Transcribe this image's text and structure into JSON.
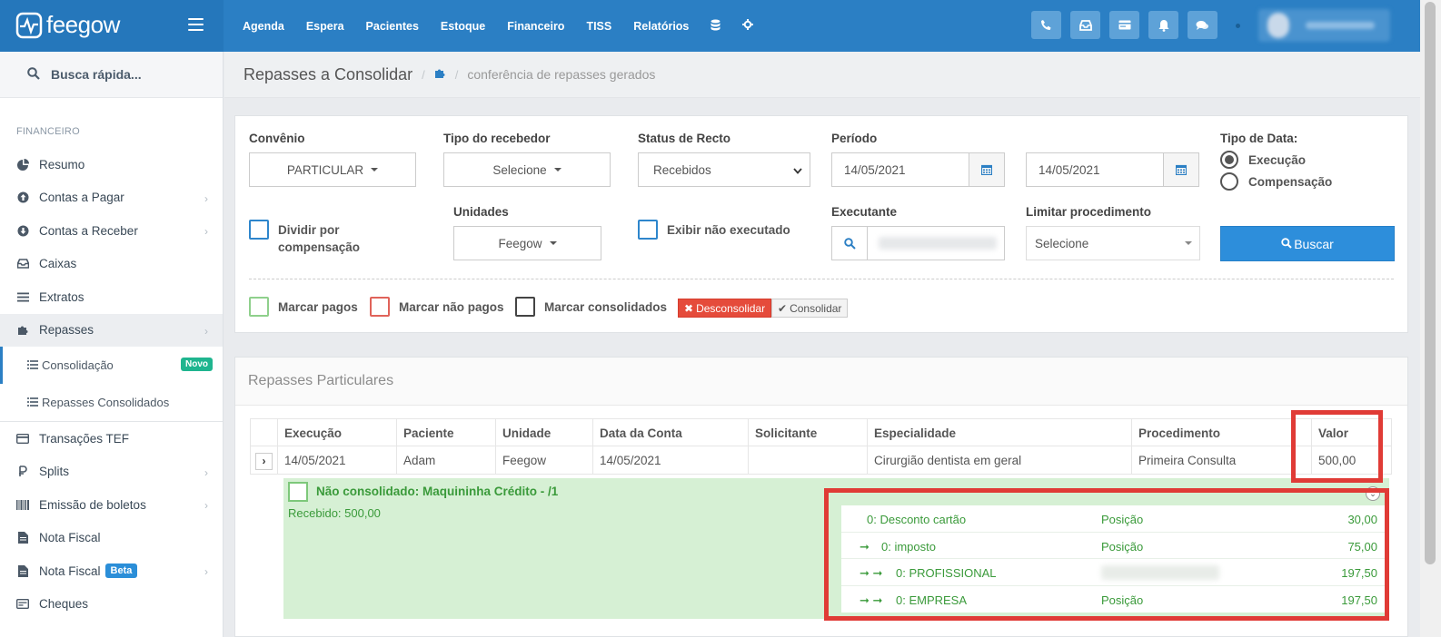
{
  "app": {
    "logo_text": "feegow",
    "brand_color": "#2b7fc4"
  },
  "nav": {
    "items": [
      "Agenda",
      "Espera",
      "Pacientes",
      "Estoque",
      "Financeiro",
      "TISS",
      "Relatórios"
    ],
    "extra_icons": [
      "database-icon",
      "gear-icon"
    ],
    "tool_icons": [
      "phone-icon",
      "inbox-icon",
      "card-icon",
      "bell-icon",
      "chat-icon"
    ]
  },
  "sidebar": {
    "search_placeholder": "Busca rápida...",
    "section": "FINANCEIRO",
    "items": [
      {
        "label": "Resumo",
        "icon": "pie-chart-icon",
        "chevron": false
      },
      {
        "label": "Contas a Pagar",
        "icon": "arrow-circle-up-icon",
        "chevron": true
      },
      {
        "label": "Contas a Receber",
        "icon": "arrow-circle-down-icon",
        "chevron": true
      },
      {
        "label": "Caixas",
        "icon": "inbox-icon",
        "chevron": false
      },
      {
        "label": "Extratos",
        "icon": "list-icon",
        "chevron": false
      },
      {
        "label": "Repasses",
        "icon": "puzzle-icon",
        "chevron": true
      }
    ],
    "sub_items": [
      {
        "label": "Consolidação",
        "badge": "Novo"
      },
      {
        "label": "Repasses Consolidados"
      }
    ],
    "items_after": [
      {
        "label": "Transações TEF",
        "icon": "credit-card-icon",
        "chevron": false
      },
      {
        "label": "Splits",
        "icon": "split-icon",
        "chevron": true
      },
      {
        "label": "Emissão de boletos",
        "icon": "barcode-icon",
        "chevron": true
      },
      {
        "label": "Nota Fiscal",
        "icon": "file-icon",
        "chevron": false
      },
      {
        "label": "Nota Fiscal",
        "icon": "file-icon",
        "chevron": true,
        "badge": "Beta"
      },
      {
        "label": "Cheques",
        "icon": "cheque-icon",
        "chevron": false
      }
    ]
  },
  "breadcrumb": {
    "title": "Repasses a Consolidar",
    "sub": "conferência de repasses gerados"
  },
  "filters": {
    "convenio": {
      "label": "Convênio",
      "value": "PARTICULAR"
    },
    "tipo_recebedor": {
      "label": "Tipo do recebedor",
      "value": "Selecione"
    },
    "status_recto": {
      "label": "Status de Recto",
      "value": "Recebidos"
    },
    "periodo": {
      "label": "Período",
      "start": "14/05/2021",
      "end": "14/05/2021"
    },
    "tipo_data": {
      "label": "Tipo de Data:",
      "options": [
        "Execução",
        "Compensação"
      ],
      "selected": "Execução"
    },
    "dividir": {
      "label_line1": "Dividir por",
      "label_line2": "compensação"
    },
    "unidades": {
      "label": "Unidades",
      "value": "Feegow"
    },
    "exibir_nao_executado": {
      "label": "Exibir não executado"
    },
    "executante": {
      "label": "Executante"
    },
    "limitar": {
      "label": "Limitar procedimento",
      "value": "Selecione"
    },
    "buscar_label": "Buscar",
    "marcar_pagos": "Marcar pagos",
    "marcar_nao_pagos": "Marcar não pagos",
    "marcar_consolidados": "Marcar consolidados",
    "desconsolidar": "Desconsolidar",
    "consolidar": "Consolidar"
  },
  "results": {
    "title": "Repasses Particulares",
    "columns": [
      "Execução",
      "Paciente",
      "Unidade",
      "Data da Conta",
      "Solicitante",
      "Especialidade",
      "Procedimento",
      "Valor"
    ],
    "rows": [
      {
        "execucao": "14/05/2021",
        "paciente": "Adam",
        "unidade": "Feegow",
        "data_conta": "14/05/2021",
        "solicitante": "",
        "especialidade": "Cirurgião dentista em geral",
        "procedimento": "Primeira Consulta",
        "valor": "500,00"
      }
    ],
    "detail": {
      "title": "Não consolidado: Maquininha Crédito - /1",
      "received": "Recebido: 500,00",
      "lines": [
        {
          "prefix": "",
          "name": "0: Desconto cartão",
          "type": "Posição",
          "value": "30,00"
        },
        {
          "prefix": "➞",
          "name": "0: imposto",
          "type": "Posição",
          "value": "75,00"
        },
        {
          "prefix": "➞ ➞",
          "name": "0: PROFISSIONAL",
          "type": "",
          "value": "197,50"
        },
        {
          "prefix": "➞ ➞",
          "name": "0: EMPRESA",
          "type": "Posição",
          "value": "197,50"
        }
      ]
    }
  }
}
